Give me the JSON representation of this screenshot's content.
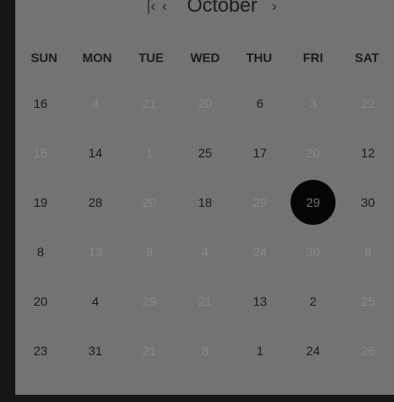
{
  "calendar": {
    "month": "October",
    "nav": {
      "first": "|‹",
      "prev": "‹",
      "next": "›"
    },
    "weekdays": [
      "SUN",
      "MON",
      "TUE",
      "WED",
      "THU",
      "FRI",
      "SAT"
    ],
    "weeks": [
      [
        {
          "label": "16",
          "muted": false
        },
        {
          "label": "4",
          "muted": true
        },
        {
          "label": "21",
          "muted": true
        },
        {
          "label": "20",
          "muted": true
        },
        {
          "label": "6",
          "muted": false
        },
        {
          "label": "3",
          "muted": true
        },
        {
          "label": "22",
          "muted": true
        }
      ],
      [
        {
          "label": "15",
          "muted": true
        },
        {
          "label": "14",
          "muted": false
        },
        {
          "label": "1",
          "muted": true
        },
        {
          "label": "25",
          "muted": false
        },
        {
          "label": "17",
          "muted": false
        },
        {
          "label": "20",
          "muted": true
        },
        {
          "label": "12",
          "muted": false
        }
      ],
      [
        {
          "label": "19",
          "muted": false
        },
        {
          "label": "28",
          "muted": false
        },
        {
          "label": "20",
          "muted": true
        },
        {
          "label": "18",
          "muted": false
        },
        {
          "label": "29",
          "muted": true
        },
        {
          "label": "29",
          "muted": false,
          "selected": true
        },
        {
          "label": "30",
          "muted": false
        }
      ],
      [
        {
          "label": "8",
          "muted": false
        },
        {
          "label": "13",
          "muted": true
        },
        {
          "label": "9",
          "muted": true
        },
        {
          "label": "4",
          "muted": true
        },
        {
          "label": "24",
          "muted": true
        },
        {
          "label": "30",
          "muted": true
        },
        {
          "label": "8",
          "muted": true
        }
      ],
      [
        {
          "label": "20",
          "muted": false
        },
        {
          "label": "4",
          "muted": false
        },
        {
          "label": "29",
          "muted": true
        },
        {
          "label": "21",
          "muted": true
        },
        {
          "label": "13",
          "muted": false
        },
        {
          "label": "2",
          "muted": false
        },
        {
          "label": "25",
          "muted": true
        }
      ],
      [
        {
          "label": "23",
          "muted": false
        },
        {
          "label": "31",
          "muted": false
        },
        {
          "label": "21",
          "muted": true
        },
        {
          "label": "8",
          "muted": true
        },
        {
          "label": "1",
          "muted": false
        },
        {
          "label": "24",
          "muted": false
        },
        {
          "label": "26",
          "muted": true
        }
      ]
    ]
  },
  "colors": {
    "background": "#161616",
    "panel": "#737373",
    "text": "#1c1c1c",
    "muted_text": "#888888",
    "selected_bg": "#050505"
  }
}
